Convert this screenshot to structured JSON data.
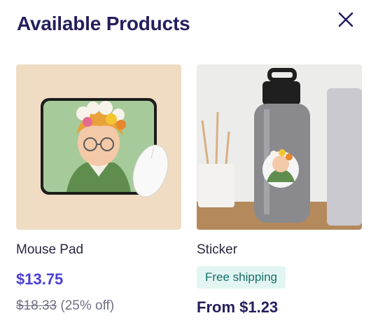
{
  "header": {
    "title": "Available Products"
  },
  "icons": {
    "close": "close-icon"
  },
  "products": [
    {
      "name": "Mouse Pad",
      "price": "$13.75",
      "original_price": "$18.33",
      "discount": "(25% off)"
    },
    {
      "name": "Sticker",
      "badge": "Free shipping",
      "price_from": "From $1.23"
    }
  ],
  "colors": {
    "title": "#241f5c",
    "price": "#4a3fd6",
    "badge_bg": "#e2f5f2",
    "badge_text": "#146e68"
  }
}
